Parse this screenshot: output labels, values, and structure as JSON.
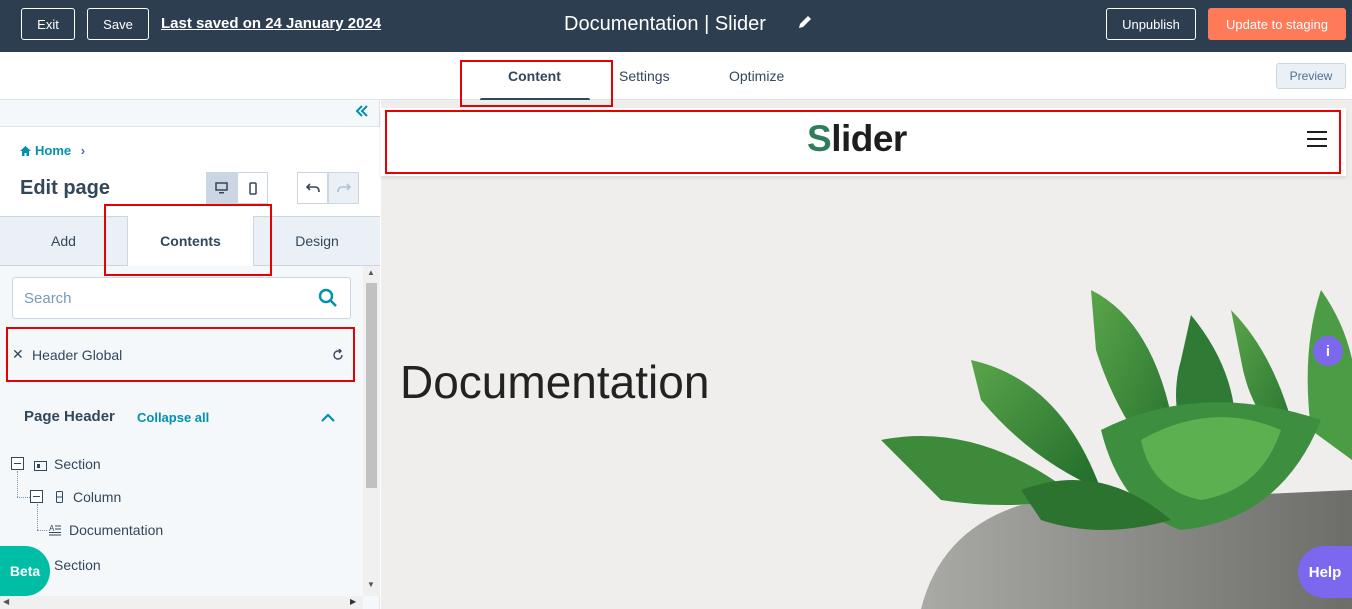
{
  "topbar": {
    "exit_label": "Exit",
    "save_label": "Save",
    "last_saved": "Last saved on 24 January 2024",
    "title": "Documentation | Slider",
    "unpublish_label": "Unpublish",
    "update_label": "Update to staging"
  },
  "tabs": [
    {
      "label": "Content"
    },
    {
      "label": "Settings"
    },
    {
      "label": "Optimize"
    }
  ],
  "preview_label": "Preview",
  "sidebar": {
    "breadcrumb_home": "Home",
    "heading": "Edit page",
    "tabs": [
      {
        "label": "Add"
      },
      {
        "label": "Contents"
      },
      {
        "label": "Design"
      }
    ],
    "search": {
      "placeholder": "Search"
    },
    "header_global": "Header Global",
    "page_header": "Page Header",
    "collapse_all": "Collapse all",
    "tree": [
      {
        "label": "Section"
      },
      {
        "label": "Column"
      },
      {
        "label": "Documentation"
      },
      {
        "label": "Section"
      }
    ],
    "beta_label": "Beta"
  },
  "site": {
    "logo_first": "S",
    "logo_rest": "lider",
    "page_title": "Documentation",
    "info_label": "i",
    "help_label": "Help"
  },
  "colors": {
    "topbar": "#2d3e50",
    "accent_orange": "#ff7a59",
    "link_teal": "#0091ae",
    "beta_teal": "#00bda5",
    "help_purple": "#7b68ee",
    "highlight_red": "#e60000"
  }
}
